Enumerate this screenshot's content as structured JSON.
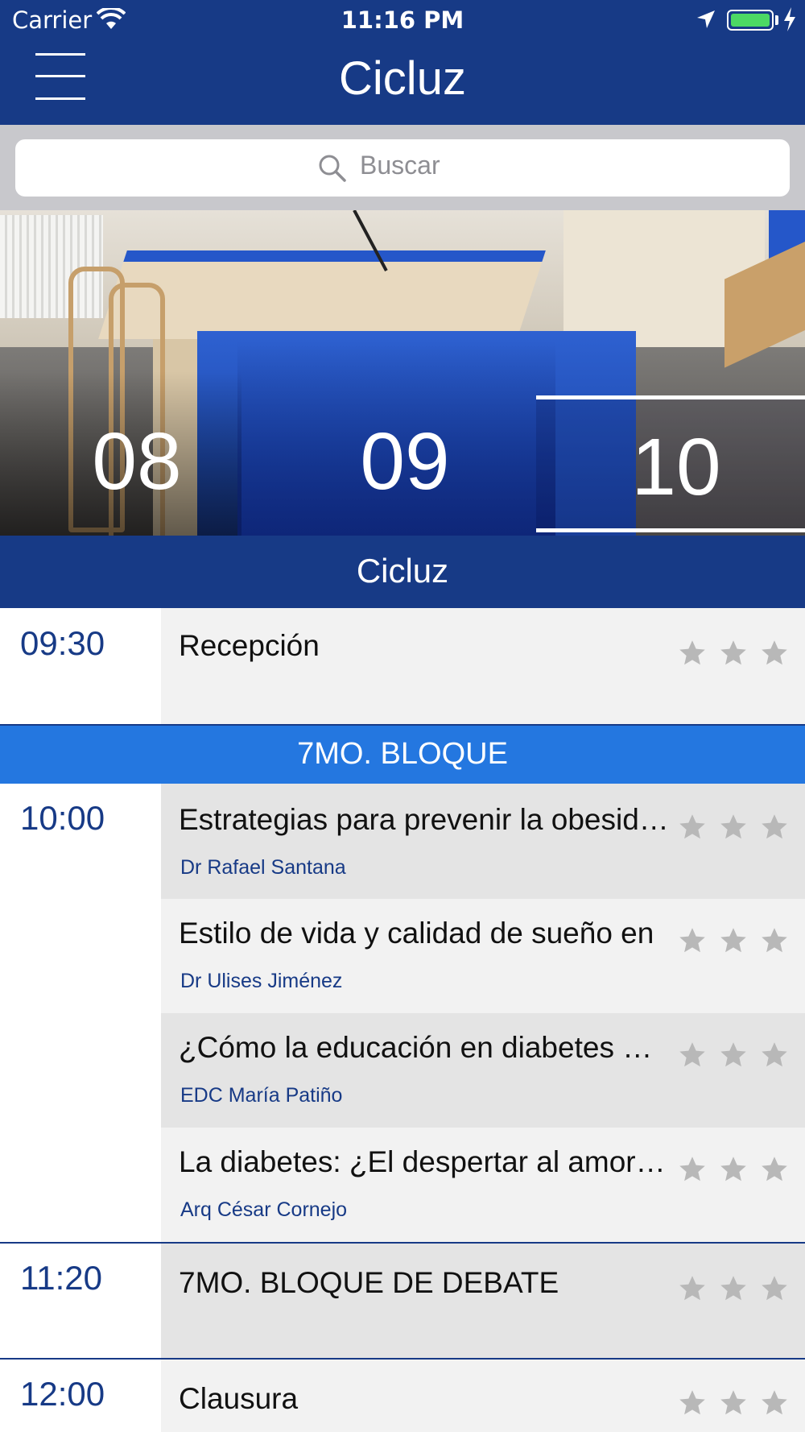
{
  "status_bar": {
    "carrier": "Carrier",
    "time": "11:16 PM"
  },
  "nav": {
    "title": "Cicluz"
  },
  "search": {
    "placeholder": "Buscar"
  },
  "days": [
    "08",
    "09",
    "10"
  ],
  "schedule": {
    "header": "Cicluz",
    "first": {
      "time": "09:30",
      "title": "Recepción"
    },
    "block_header": "7MO. BLOQUE",
    "block_time": "10:00",
    "talks": [
      {
        "title": "Estrategias para prevenir la obesidad",
        "speaker": "Dr Rafael Santana"
      },
      {
        "title": "Estilo de vida y calidad de sueño en",
        "speaker": "Dr Ulises Jiménez"
      },
      {
        "title": "¿Cómo la educación en diabetes mejora",
        "speaker": "EDC María Patiño"
      },
      {
        "title": "La diabetes: ¿El despertar al amor infinito?",
        "speaker": "Arq César Cornejo"
      }
    ],
    "debate": {
      "time": "11:20",
      "title": "7MO. BLOQUE DE DEBATE"
    },
    "closing": {
      "time": "12:00",
      "title": "Clausura"
    }
  },
  "colors": {
    "nav": "#173a86",
    "block": "#2477e0",
    "star": "#b8b8b8",
    "speaker": "#173a86"
  },
  "icons": [
    "menu-icon",
    "search-icon",
    "wifi-icon",
    "location-icon",
    "battery-icon",
    "charging-icon",
    "star-icon"
  ]
}
